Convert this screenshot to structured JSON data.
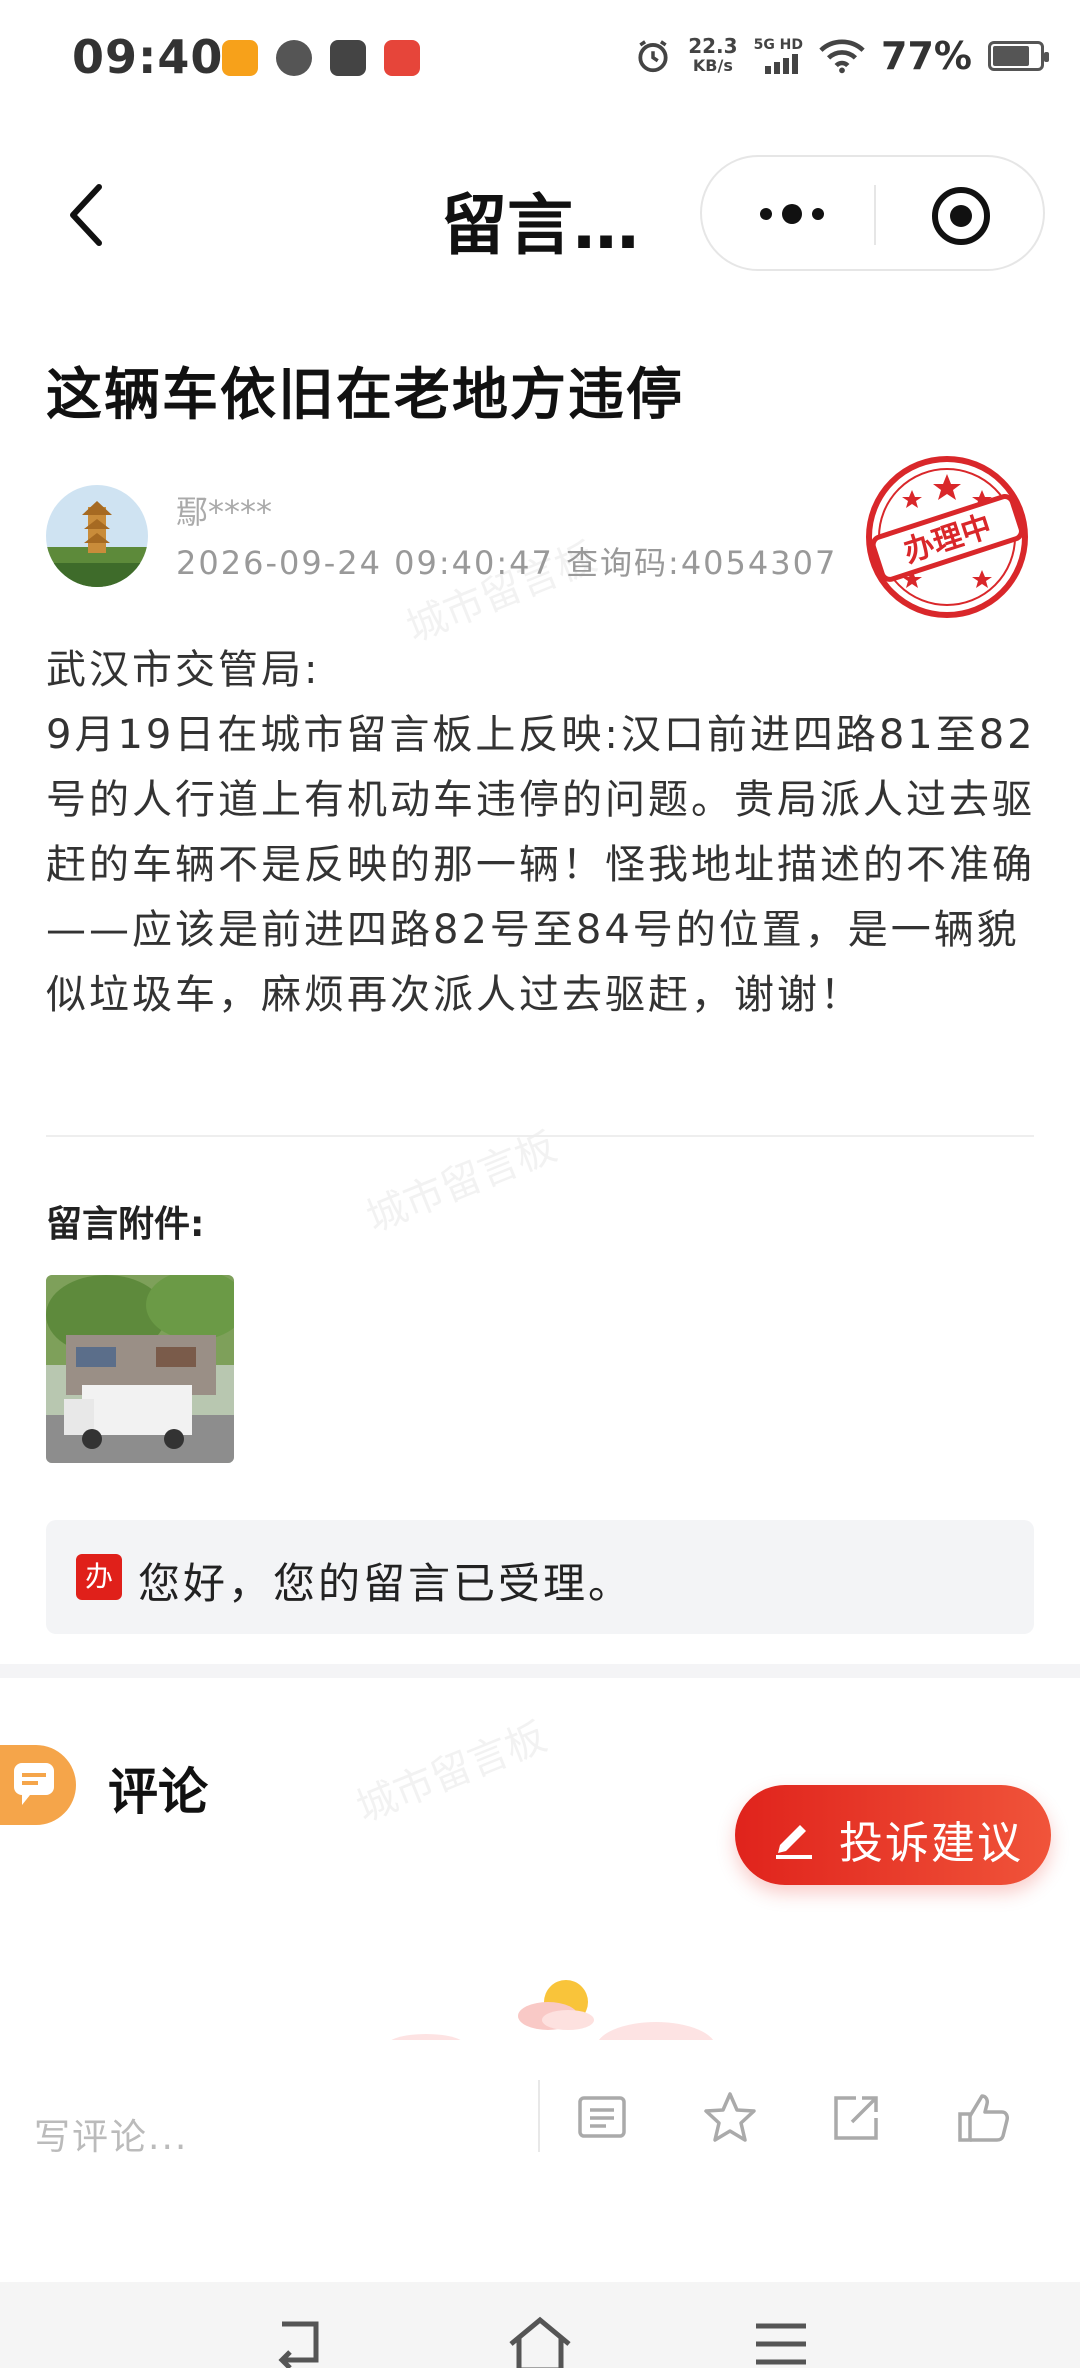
{
  "status_bar": {
    "time": "09:40",
    "net_speed_value": "22.3",
    "net_speed_unit": "KB/s",
    "network": "5G HD",
    "battery": "77%"
  },
  "nav": {
    "title": "留言…"
  },
  "post": {
    "title": "这辆车依旧在老地方违停",
    "author": "鄢****",
    "meta": "2026-09-24 09:40:47 查询码:4054307",
    "stamp": "办理中",
    "body": [
      "武汉市交管局:",
      "9月19日在城市留言板上反映:汉口前进四路81至82号的人行道上有机动车违停的问题。贵局派人过去驱赶的车辆不是反映的那一辆！怪我地址描述的不准确——应该是前进四路82号至84号的位置，是一辆貌似垃圾车，麻烦再次派人过去驱赶，谢谢！"
    ],
    "attachment_label": "留言附件:"
  },
  "reply": {
    "badge": "办",
    "text": "您好，您的留言已受理。"
  },
  "comments": {
    "title": "评论",
    "complain_button": "投诉建议",
    "input_placeholder": "写评论..."
  },
  "watermark": "城市留言板",
  "colors": {
    "accent_red": "#e0201a",
    "comment_tab_orange": "#f5a54a"
  }
}
